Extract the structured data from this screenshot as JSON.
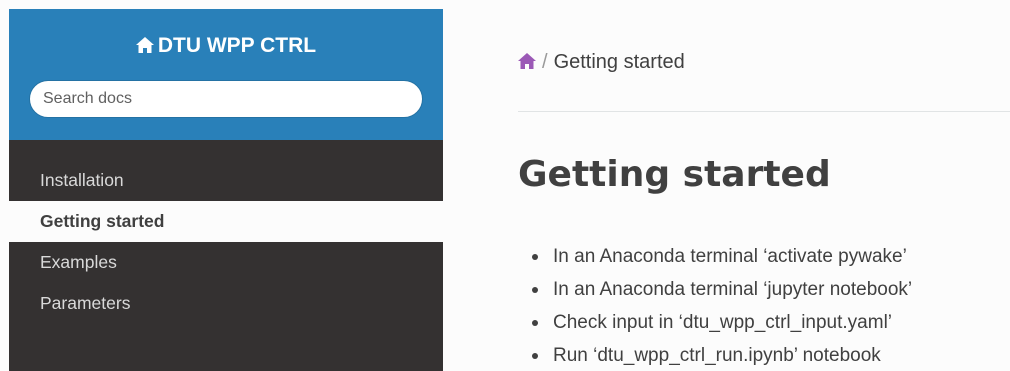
{
  "colors": {
    "sidebar_top": "#2980b9",
    "sidebar_nav": "#343131",
    "content_bg": "#fcfcfc",
    "text": "#404040",
    "home_icon_breadcrumb": "#9b59b6"
  },
  "sidebar": {
    "project_icon": "home-icon",
    "project_name": "DTU WPP CTRL",
    "search": {
      "placeholder": "Search docs",
      "value": ""
    },
    "items": [
      {
        "label": "Installation",
        "state": "normal"
      },
      {
        "label": "Getting started",
        "state": "current"
      },
      {
        "label": "Examples",
        "state": "normal"
      },
      {
        "label": "Parameters",
        "state": "normal"
      }
    ]
  },
  "breadcrumb": {
    "home_icon": "home-icon",
    "separator": "/",
    "current": "Getting started"
  },
  "main": {
    "title": "Getting started",
    "steps": [
      "In an Anaconda terminal ‘activate pywake’",
      "In an Anaconda terminal ‘jupyter notebook’",
      "Check input in ‘dtu_wpp_ctrl_input.yaml’",
      "Run ‘dtu_wpp_ctrl_run.ipynb’ notebook"
    ]
  }
}
